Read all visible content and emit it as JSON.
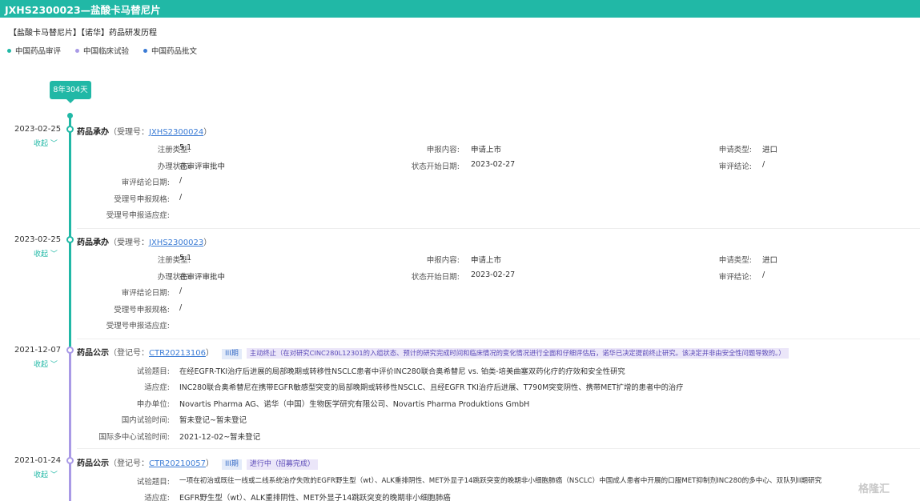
{
  "window": {
    "title": "JXHS2300023—盐酸卡马替尼片"
  },
  "heading": "【盐酸卡马替尼片】【诺华】药品研发历程",
  "legend": [
    {
      "label": "中国药品审评",
      "color": "#21b8a6"
    },
    {
      "label": "中国临床试验",
      "color": "#a99ae6"
    },
    {
      "label": "中国药品批文",
      "color": "#3a7bd5"
    }
  ],
  "duration_badge": "8年304天",
  "collapse_label": "收起 ﹀",
  "events": [
    {
      "date": "2023-02-25",
      "type": "药品承办",
      "id_label": "（受理号：",
      "id": "JXHS2300024",
      "id_close": "）",
      "fields": {
        "reg_type_label": "注册类型:",
        "reg_type": "5.1",
        "content_label": "申报内容:",
        "content": "申请上市",
        "apply_type_label": "申请类型:",
        "apply_type": "进口",
        "status_label": "办理状态:",
        "status": "在审评审批中",
        "start_date_label": "状态开始日期:",
        "start_date": "2023-02-27",
        "conclusion_label": "审评结论:",
        "conclusion": "/",
        "conclusion_date_label": "审评结论日期:",
        "conclusion_date": "/",
        "spec_label": "受理号申报规格:",
        "spec": "/",
        "indication_label": "受理号申报适应症:",
        "indication": ""
      }
    },
    {
      "date": "2023-02-25",
      "type": "药品承办",
      "id_label": "（受理号：",
      "id": "JXHS2300023",
      "id_close": "）",
      "fields": {
        "reg_type_label": "注册类型:",
        "reg_type": "5.1",
        "content_label": "申报内容:",
        "content": "申请上市",
        "apply_type_label": "申请类型:",
        "apply_type": "进口",
        "status_label": "办理状态:",
        "status": "在审评审批中",
        "start_date_label": "状态开始日期:",
        "start_date": "2023-02-27",
        "conclusion_label": "审评结论:",
        "conclusion": "/",
        "conclusion_date_label": "审评结论日期:",
        "conclusion_date": "/",
        "spec_label": "受理号申报规格:",
        "spec": "/",
        "indication_label": "受理号申报适应症:",
        "indication": ""
      }
    },
    {
      "date": "2021-12-07",
      "type": "药品公示",
      "id_label": "（登记号：",
      "id": "CTR20213106",
      "id_close": "）",
      "phase": "III期",
      "status_badge": "主动终止（在对研究CINC280L12301的入组状态、预计的研究完成时间和临床情况的变化情况进行全面和仔细评估后，诺华已决定提前终止研究。该决定并非由安全性问题导致的。）",
      "fields": {
        "title_label": "试验题目:",
        "title": "在经EGFR-TKI治疗后进展的局部晚期或转移性NSCLC患者中评价INC280联合奥希替尼 vs. 铂类-培美曲塞双药化疗的疗效和安全性研究",
        "indication_label": "适应症:",
        "indication": "INC280联合奥希替尼在携带EGFR敏感型突变的局部晚期或转移性NSCLC、且经EGFR TKI治疗后进展、T790M突变阴性、携带MET扩增的患者中的治疗",
        "sponsor_label": "申办单位:",
        "sponsor": "Novartis Pharma AG、诺华（中国）生物医学研究有限公司、Novartis Pharma Produktions GmbH",
        "domestic_label": "国内试验时间:",
        "domestic": "暂未登记~暂未登记",
        "intl_label": "国际多中心试验时间:",
        "intl": "2021-12-02~暂未登记"
      }
    },
    {
      "date": "2021-01-24",
      "type": "药品公示",
      "id_label": "（登记号：",
      "id": "CTR20210057",
      "id_close": "）",
      "phase": "III期",
      "status_badge": "进行中（招募完成）",
      "fields": {
        "title_label": "试验题目:",
        "title": "一项在初治或既往一线或二线系统治疗失败的EGFR野生型（wt）、ALK重排阴性、MET外显子14跳跃突变的晚期非小细胞肺癌（NSCLC）中国成人患者中开展的口服MET抑制剂INC280的多中心、双队列II期研究",
        "indication_label": "适应症:",
        "indication": "EGFR野生型（wt）、ALK重排阴性、MET外显子14跳跃突变的晚期非小细胞肺癌"
      }
    }
  ],
  "watermark": "格隆汇"
}
